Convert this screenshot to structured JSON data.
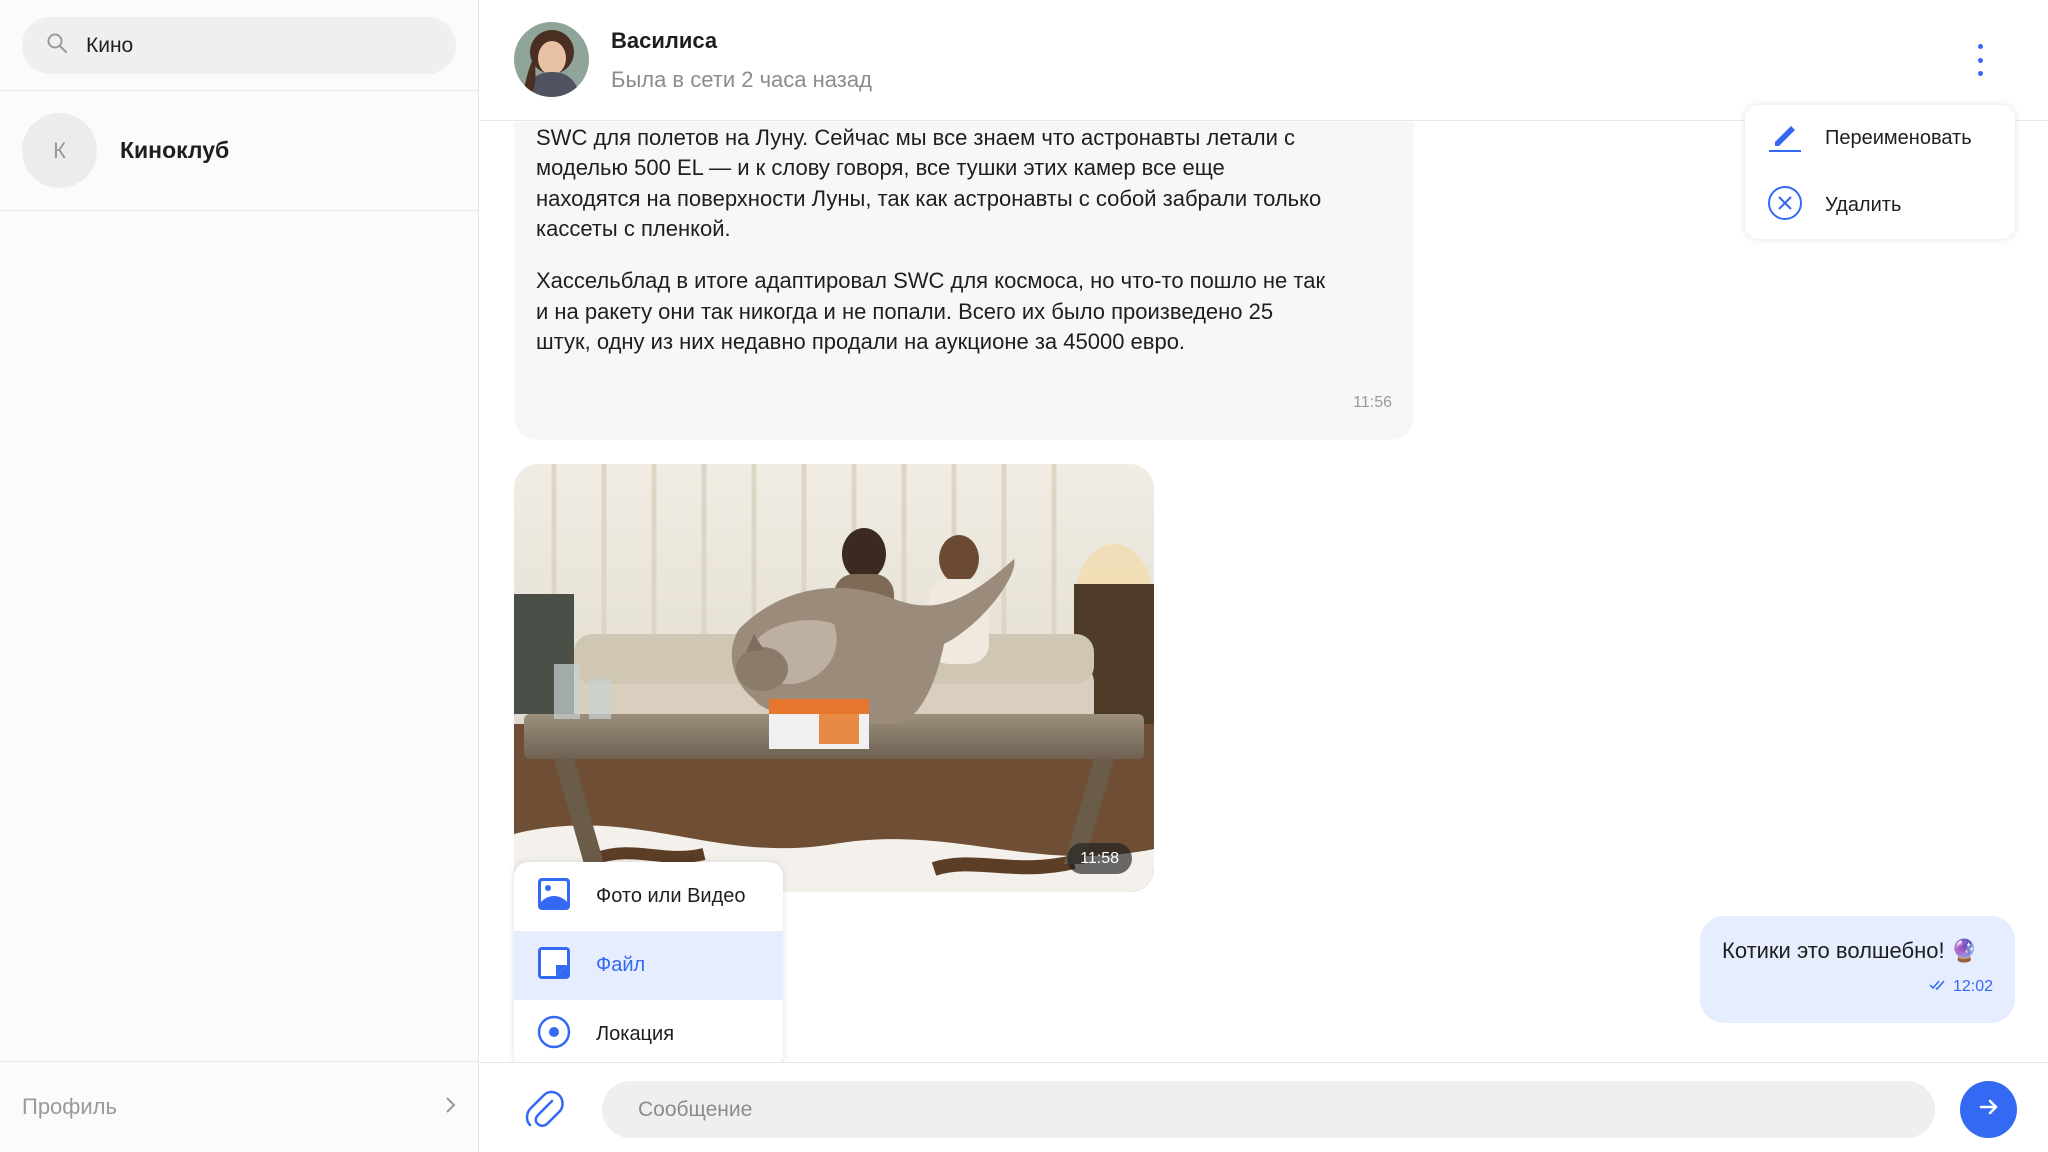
{
  "sidebar": {
    "search": {
      "value": "Кино",
      "icon": "search-icon"
    },
    "chats": [
      {
        "avatar_letter": "К",
        "name": "Киноклуб"
      }
    ],
    "profile_label": "Профиль"
  },
  "header": {
    "name": "Василиса",
    "status": "Была в сети 2 часа назад"
  },
  "messages": {
    "incoming_text_p1": "— НАСА в какой-то момент попросила Хассельблад адаптировать модель\nSWC для полетов на Луну. Сейчас мы все знаем что астронавты летали с\nмоделью 500 EL — и к слову говоря, все тушки этих камер все еще\nнаходятся на поверхности Луны, так как астронавты с собой забрали только\nкассеты с пленкой.",
    "incoming_text_p2": "Хассельблад в итоге адаптировал SWC для космоса, но что-то пошло не так\nи на ракету они так никогда и не попали. Всего их было произведено 25\nштук, одну из них недавно продали на аукционе за 45000 евро.",
    "incoming_time": "11:56",
    "photo_time": "11:58",
    "outgoing_text": "Котики это волшебно! 🔮",
    "outgoing_time": "12:02"
  },
  "attach_menu": {
    "items": [
      {
        "label": "Фото или Видео",
        "icon": "photo-video-icon"
      },
      {
        "label": "Файл",
        "icon": "file-icon"
      },
      {
        "label": "Локация",
        "icon": "location-icon"
      }
    ]
  },
  "options_menu": {
    "items": [
      {
        "label": "Переименовать",
        "icon": "pencil-icon"
      },
      {
        "label": "Удалить",
        "icon": "close-circle-icon"
      }
    ]
  },
  "composer": {
    "placeholder": "Сообщение"
  },
  "colors": {
    "accent": "#3369f3",
    "outgoing_bubble": "#e5edff",
    "incoming_bubble": "#f7f7f7"
  }
}
